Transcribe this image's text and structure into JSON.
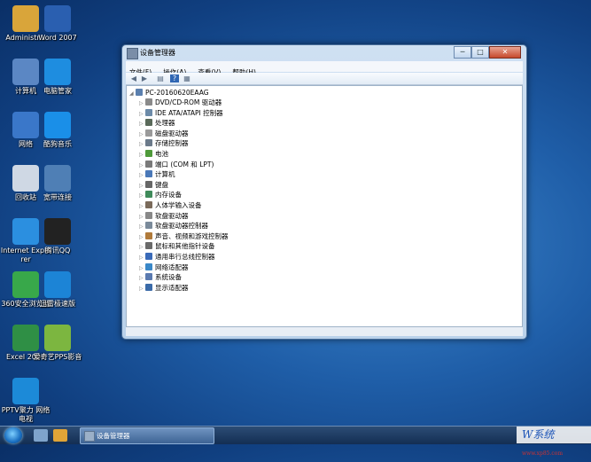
{
  "desktop_icons": [
    {
      "label": "Administr...",
      "color": "#d9a53a",
      "icon": "user-folder-icon"
    },
    {
      "label": "Word 2007",
      "color": "#2a5fb0",
      "icon": "word-icon"
    },
    {
      "label": "计算机",
      "color": "#5b87c4",
      "icon": "computer-icon"
    },
    {
      "label": "电脑管家",
      "color": "#1e8de0",
      "icon": "shield-icon"
    },
    {
      "label": "网络",
      "color": "#3a77c9",
      "icon": "network-icon"
    },
    {
      "label": "酷狗音乐",
      "color": "#1a8fe8",
      "icon": "kugou-icon"
    },
    {
      "label": "回收站",
      "color": "#cfd8e4",
      "icon": "recycle-bin-icon"
    },
    {
      "label": "宽带连接",
      "color": "#4f7fb5",
      "icon": "broadband-icon"
    },
    {
      "label": "Internet Explorer",
      "color": "#2b8fe0",
      "icon": "ie-icon"
    },
    {
      "label": "腾讯QQ",
      "color": "#222222",
      "icon": "qq-icon"
    },
    {
      "label": "360安全浏览器",
      "color": "#38a84a",
      "icon": "360-browser-icon"
    },
    {
      "label": "迅雷极速版",
      "color": "#1c84d6",
      "icon": "xunlei-icon"
    },
    {
      "label": "Excel 2007",
      "color": "#2f8f45",
      "icon": "excel-icon"
    },
    {
      "label": "爱奇艺PPS影音",
      "color": "#7cb640",
      "icon": "iqiyi-pps-icon"
    },
    {
      "label": "PPTV聚力 网络电视",
      "color": "#1c8ad8",
      "icon": "pptv-icon"
    }
  ],
  "window": {
    "title": "设备管理器",
    "buttons": {
      "minimize": "─",
      "maximize": "□",
      "close": "✕"
    },
    "menu": [
      "文件(F)",
      "操作(A)",
      "查看(V)",
      "帮助(H)"
    ],
    "toolbar": [
      "◀",
      "▶",
      "▤",
      "?",
      "▦"
    ],
    "tree": {
      "root": "PC-20160620EAAG",
      "items": [
        {
          "label": "DVD/CD-ROM 驱动器",
          "color": "#8a8a8a"
        },
        {
          "label": "IDE ATA/ATAPI 控制器",
          "color": "#6c8aa8"
        },
        {
          "label": "处理器",
          "color": "#5a6a5a"
        },
        {
          "label": "磁盘驱动器",
          "color": "#9a9a9a"
        },
        {
          "label": "存储控制器",
          "color": "#6b7a8a"
        },
        {
          "label": "电池",
          "color": "#4f9a3a"
        },
        {
          "label": "端口 (COM 和 LPT)",
          "color": "#7a7a7a"
        },
        {
          "label": "计算机",
          "color": "#4a78b8"
        },
        {
          "label": "键盘",
          "color": "#666666"
        },
        {
          "label": "内存设备",
          "color": "#3f8a5a"
        },
        {
          "label": "人体学输入设备",
          "color": "#7a6a5a"
        },
        {
          "label": "软盘驱动器",
          "color": "#888888"
        },
        {
          "label": "软盘驱动器控制器",
          "color": "#7a8a9a"
        },
        {
          "label": "声音、视频和游戏控制器",
          "color": "#b07a3a"
        },
        {
          "label": "鼠标和其他指针设备",
          "color": "#6a6a6a"
        },
        {
          "label": "通用串行总线控制器",
          "color": "#3a6ab8"
        },
        {
          "label": "网络适配器",
          "color": "#3a88c8"
        },
        {
          "label": "系统设备",
          "color": "#5a7ab0"
        },
        {
          "label": "显示适配器",
          "color": "#3a6aa8"
        }
      ]
    }
  },
  "taskbar": {
    "active_task": "设备管理器",
    "tray_text": "◂ ⚑"
  },
  "watermark": {
    "text": "W系统",
    "small": "www.xp85.com"
  }
}
